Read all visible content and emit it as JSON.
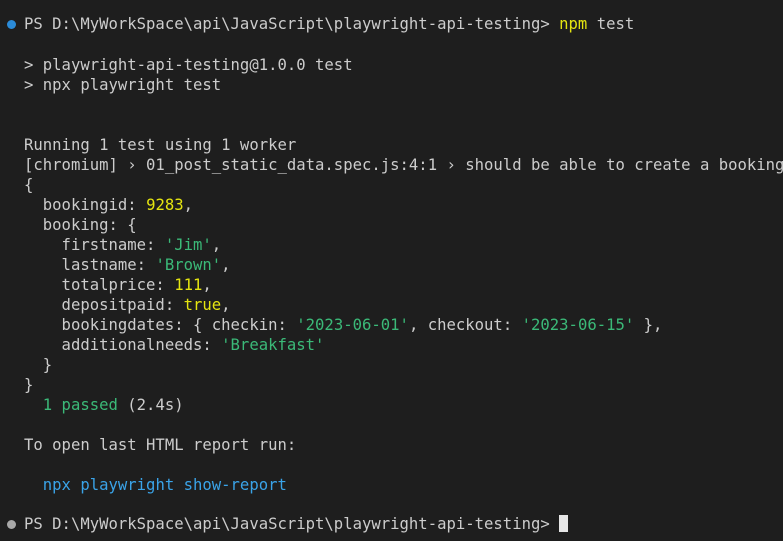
{
  "terminal": {
    "prompt_line": {
      "prompt": "PS D:\\MyWorkSpace\\api\\JavaScript\\playwright-api-testing>",
      "command": "npm",
      "args": "test"
    },
    "script_header_1": "> playwright-api-testing@1.0.0 test",
    "script_header_2": "> npx playwright test",
    "running_line": "Running 1 test using 1 worker",
    "test_title_line": "[chromium] › 01_post_static_data.spec.js:4:1 › should be able to create a booking",
    "output": {
      "open_brace": "{",
      "bookingid_key": "  bookingid: ",
      "bookingid_value": "9283",
      "booking_key": "  booking: {",
      "firstname_key": "    firstname: ",
      "firstname_value": "'Jim'",
      "lastname_key": "    lastname: ",
      "lastname_value": "'Brown'",
      "totalprice_key": "    totalprice: ",
      "totalprice_value": "111",
      "depositpaid_key": "    depositpaid: ",
      "depositpaid_value": "true",
      "bookingdates_key": "    bookingdates: { checkin: ",
      "checkin_value": "'2023-06-01'",
      "checkout_key": ", checkout: ",
      "checkout_value": "'2023-06-15'",
      "bookingdates_end": " },",
      "additionalneeds_key": "    additionalneeds: ",
      "additionalneeds_value": "'Breakfast'",
      "booking_close": "  }",
      "close_brace": "}"
    },
    "passed_label": "1 passed",
    "passed_time": " (2.4s)",
    "report_hint": "To open last HTML report run:",
    "report_command": "npx playwright show-report",
    "final_prompt": "PS D:\\MyWorkSpace\\api\\JavaScript\\playwright-api-testing>"
  },
  "colors": {
    "background": "#1e1e1e",
    "text": "#cccccc",
    "command": "#e5e510",
    "number": "#e5e510",
    "string": "#3bb978",
    "passed": "#23b7a5",
    "link": "#3aa3e8",
    "dot_active": "#2b8bd8",
    "dot_idle": "#a8a8a8"
  }
}
